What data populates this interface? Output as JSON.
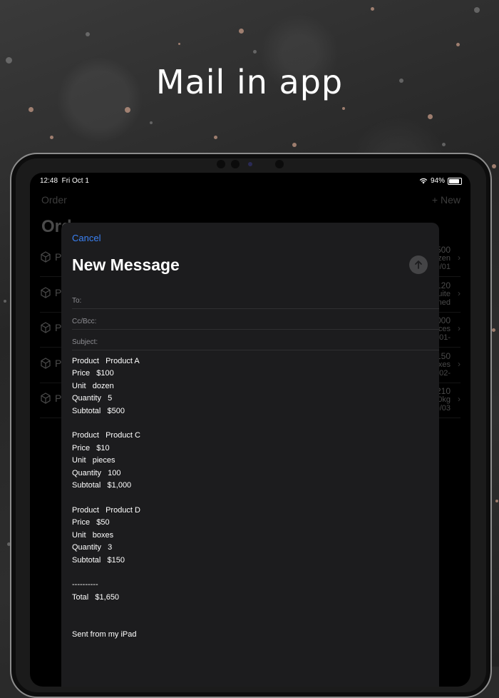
{
  "headline": "Mail in app",
  "status": {
    "time": "12:48",
    "date": "Fri Oct 1",
    "battery": "94%"
  },
  "background": {
    "nav_left": "Order",
    "nav_right": "+ New",
    "title": "Ord",
    "rows": [
      {
        "p": "P",
        "line1": "500",
        "line2": "ozen",
        "line3": "0/01"
      },
      {
        "p": "P",
        "line1": "120",
        "line2": "uite",
        "line3": "gned"
      },
      {
        "p": "P",
        "line1": "000",
        "line2": "ces",
        "line3": "0/01-"
      },
      {
        "p": "P",
        "line1": "150",
        "line2": "oxes",
        "line3": "0/02-"
      },
      {
        "p": "P",
        "line1": "210",
        "line2": "0kg",
        "line3": "0/03"
      }
    ]
  },
  "compose": {
    "cancel": "Cancel",
    "title": "New Message",
    "to_label": "To:",
    "cc_label": "Cc/Bcc:",
    "subject_label": "Subject:",
    "body": "Product   Product A\nPrice   $100\nUnit   dozen\nQuantity   5\nSubtotal   $500\n\nProduct   Product C\nPrice   $10\nUnit   pieces\nQuantity   100\nSubtotal   $1,000\n\nProduct   Product D\nPrice   $50\nUnit   boxes\nQuantity   3\nSubtotal   $150\n\n----------\nTotal   $1,650\n\n\nSent from my iPad"
  },
  "colors": {
    "accent": "#3b82f6",
    "sheet": "#1c1c1e"
  }
}
